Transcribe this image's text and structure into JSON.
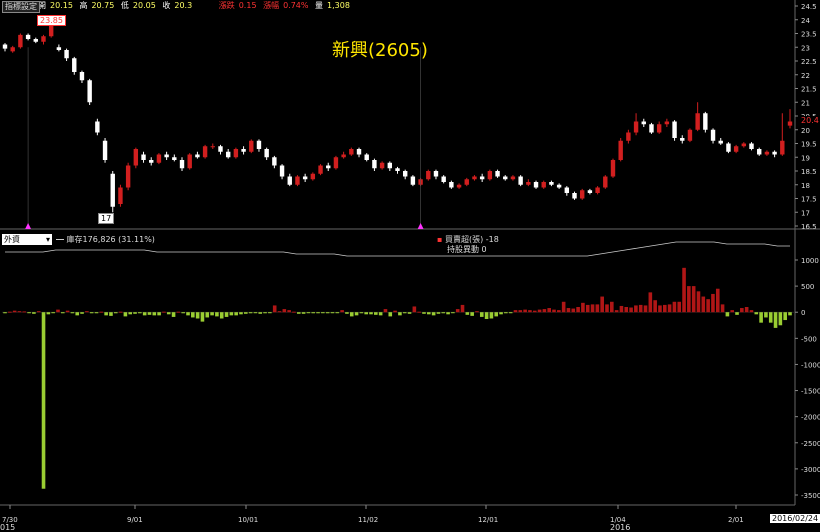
{
  "header": {
    "button": "指標設定",
    "open_label": "開",
    "open": "20.15",
    "high_label": "高",
    "high": "20.75",
    "low_label": "低",
    "low": "20.05",
    "close_label": "收",
    "close": "20.3",
    "change_label": "漲跌",
    "change": "0.15",
    "pct_label": "漲幅",
    "pct": "0.74%",
    "vol_label": "量",
    "vol": "1,308"
  },
  "title": "新興(2605)",
  "price_chart": {
    "type": "candlestick",
    "y_ticks": [
      "24.5",
      "24",
      "23.5",
      "23",
      "22.5",
      "22",
      "21.5",
      "21",
      "20.5",
      "20",
      "19.5",
      "19",
      "18.5",
      "18",
      "17.5",
      "17",
      "16.5"
    ],
    "high_label": "23.85",
    "low_label": "17",
    "last_label": "20.4",
    "candles": [
      [
        23.1,
        22.95,
        23.15,
        22.85
      ],
      [
        22.85,
        23.0,
        23.05,
        22.8
      ],
      [
        23.0,
        23.45,
        23.5,
        22.95
      ],
      [
        23.45,
        23.3,
        23.5,
        23.25
      ],
      [
        23.3,
        23.2,
        23.35,
        23.15
      ],
      [
        23.2,
        23.4,
        23.45,
        23.1
      ],
      [
        23.4,
        23.8,
        23.85,
        23.35
      ],
      [
        23.0,
        22.9,
        23.1,
        22.85
      ],
      [
        22.9,
        22.6,
        22.95,
        22.5
      ],
      [
        22.6,
        22.1,
        22.65,
        22.0
      ],
      [
        22.1,
        21.8,
        22.15,
        21.7
      ],
      [
        21.8,
        21.0,
        21.85,
        20.9
      ],
      [
        20.3,
        19.9,
        20.4,
        19.8
      ],
      [
        19.6,
        18.9,
        19.7,
        18.8
      ],
      [
        18.4,
        17.2,
        18.5,
        17.0
      ],
      [
        17.3,
        17.9,
        18.0,
        17.2
      ],
      [
        17.9,
        18.7,
        18.8,
        17.8
      ],
      [
        18.7,
        19.3,
        19.35,
        18.6
      ],
      [
        19.1,
        18.9,
        19.2,
        18.8
      ],
      [
        18.9,
        18.8,
        19.0,
        18.7
      ],
      [
        18.8,
        19.1,
        19.15,
        18.75
      ],
      [
        19.1,
        19.0,
        19.2,
        18.9
      ],
      [
        19.0,
        18.9,
        19.1,
        18.85
      ],
      [
        18.9,
        18.6,
        19.0,
        18.5
      ],
      [
        18.6,
        19.1,
        19.15,
        18.55
      ],
      [
        19.1,
        19.0,
        19.2,
        18.95
      ],
      [
        19.0,
        19.4,
        19.45,
        18.95
      ],
      [
        19.4,
        19.4,
        19.5,
        19.3
      ],
      [
        19.4,
        19.2,
        19.45,
        19.1
      ],
      [
        19.2,
        19.0,
        19.3,
        18.95
      ],
      [
        19.0,
        19.3,
        19.35,
        18.95
      ],
      [
        19.3,
        19.2,
        19.4,
        19.1
      ],
      [
        19.2,
        19.6,
        19.65,
        19.15
      ],
      [
        19.6,
        19.3,
        19.65,
        19.2
      ],
      [
        19.3,
        19.0,
        19.35,
        18.9
      ],
      [
        19.0,
        18.7,
        19.05,
        18.6
      ],
      [
        18.7,
        18.3,
        18.75,
        18.2
      ],
      [
        18.3,
        18.0,
        18.4,
        17.95
      ],
      [
        18.0,
        18.3,
        18.35,
        17.95
      ],
      [
        18.3,
        18.2,
        18.4,
        18.1
      ],
      [
        18.2,
        18.4,
        18.45,
        18.15
      ],
      [
        18.4,
        18.7,
        18.75,
        18.35
      ],
      [
        18.7,
        18.6,
        18.8,
        18.5
      ],
      [
        18.6,
        19.0,
        19.05,
        18.55
      ],
      [
        19.0,
        19.1,
        19.2,
        18.95
      ],
      [
        19.1,
        19.3,
        19.35,
        19.05
      ],
      [
        19.3,
        19.1,
        19.35,
        19.0
      ],
      [
        19.1,
        18.9,
        19.15,
        18.85
      ],
      [
        18.9,
        18.6,
        18.95,
        18.5
      ],
      [
        18.6,
        18.8,
        18.85,
        18.55
      ],
      [
        18.8,
        18.6,
        18.85,
        18.5
      ],
      [
        18.6,
        18.5,
        18.65,
        18.4
      ],
      [
        18.5,
        18.3,
        18.55,
        18.2
      ],
      [
        18.3,
        18.0,
        18.35,
        17.95
      ],
      [
        18.0,
        18.2,
        18.25,
        17.95
      ],
      [
        18.2,
        18.5,
        18.55,
        18.15
      ],
      [
        18.5,
        18.3,
        18.55,
        18.2
      ],
      [
        18.3,
        18.1,
        18.35,
        18.05
      ],
      [
        18.1,
        17.9,
        18.15,
        17.85
      ],
      [
        17.9,
        18.0,
        18.05,
        17.85
      ],
      [
        18.0,
        18.2,
        18.25,
        17.95
      ],
      [
        18.2,
        18.3,
        18.35,
        18.15
      ],
      [
        18.3,
        18.2,
        18.4,
        18.1
      ],
      [
        18.2,
        18.5,
        18.55,
        18.15
      ],
      [
        18.5,
        18.3,
        18.55,
        18.25
      ],
      [
        18.3,
        18.2,
        18.35,
        18.15
      ],
      [
        18.2,
        18.3,
        18.35,
        18.15
      ],
      [
        18.3,
        18.0,
        18.35,
        17.95
      ],
      [
        18.0,
        18.1,
        18.2,
        17.95
      ],
      [
        18.1,
        17.9,
        18.15,
        17.85
      ],
      [
        17.9,
        18.1,
        18.15,
        17.85
      ],
      [
        18.1,
        18.0,
        18.15,
        17.95
      ],
      [
        18.0,
        17.9,
        18.05,
        17.85
      ],
      [
        17.9,
        17.7,
        17.95,
        17.6
      ],
      [
        17.7,
        17.5,
        17.75,
        17.45
      ],
      [
        17.5,
        17.8,
        17.85,
        17.45
      ],
      [
        17.8,
        17.7,
        17.85,
        17.65
      ],
      [
        17.7,
        17.9,
        17.95,
        17.65
      ],
      [
        17.9,
        18.3,
        18.35,
        17.85
      ],
      [
        18.3,
        18.9,
        18.95,
        18.25
      ],
      [
        18.9,
        19.6,
        19.7,
        18.85
      ],
      [
        19.6,
        19.9,
        20.0,
        19.5
      ],
      [
        19.9,
        20.3,
        20.6,
        19.8
      ],
      [
        20.3,
        20.2,
        20.4,
        20.1
      ],
      [
        20.2,
        19.9,
        20.25,
        19.85
      ],
      [
        19.9,
        20.2,
        20.3,
        19.85
      ],
      [
        20.2,
        20.3,
        20.4,
        20.1
      ],
      [
        20.3,
        19.7,
        20.35,
        19.6
      ],
      [
        19.7,
        19.6,
        19.8,
        19.5
      ],
      [
        19.6,
        20.0,
        20.05,
        19.55
      ],
      [
        20.0,
        20.6,
        21.0,
        19.95
      ],
      [
        20.6,
        20.0,
        20.65,
        19.9
      ],
      [
        20.0,
        19.6,
        20.05,
        19.5
      ],
      [
        19.6,
        19.5,
        19.7,
        19.45
      ],
      [
        19.5,
        19.2,
        19.55,
        19.15
      ],
      [
        19.2,
        19.4,
        19.45,
        19.15
      ],
      [
        19.4,
        19.5,
        19.55,
        19.35
      ],
      [
        19.5,
        19.3,
        19.55,
        19.25
      ],
      [
        19.3,
        19.1,
        19.35,
        19.05
      ],
      [
        19.1,
        19.2,
        19.25,
        19.05
      ],
      [
        19.2,
        19.1,
        19.25,
        19.0
      ],
      [
        19.1,
        19.6,
        20.6,
        19.05
      ],
      [
        20.15,
        20.3,
        20.75,
        20.05
      ]
    ],
    "markers": [
      3,
      54
    ]
  },
  "indicator": {
    "select_value": "外資",
    "inventory_label": "庫存176,826 (31.11%)",
    "buy_sell_label": "買賣超(張)",
    "buy_sell_value": "-18",
    "hold_change_label": "持股異動",
    "hold_change_value": "0",
    "y_ticks": [
      "1000",
      "500",
      "0",
      "-500",
      "-1000",
      "-1500",
      "-2000",
      "-2500",
      "-3000",
      "-3500"
    ],
    "bars": [
      -20,
      10,
      30,
      20,
      15,
      -5,
      -30,
      20,
      -3380,
      -40,
      -10,
      50,
      -20,
      30,
      -20,
      -60,
      -30,
      20,
      -20,
      -20,
      10,
      -60,
      -70,
      -20,
      10,
      -80,
      -40,
      -30,
      -20,
      -60,
      -50,
      -60,
      -60,
      10,
      -40,
      -90,
      10,
      -20,
      -60,
      -100,
      -120,
      -180,
      -100,
      -60,
      -80,
      -120,
      -90,
      -60,
      -60,
      -40,
      -30,
      -20,
      -10,
      -30,
      -20,
      -10,
      130,
      20,
      60,
      40,
      10,
      -30,
      -30,
      -10,
      -20,
      -20,
      -10,
      -20,
      -10,
      -10,
      40,
      -30,
      -80,
      -60,
      -20,
      -40,
      -40,
      -50,
      -60,
      60,
      -80,
      30,
      -60,
      -20,
      -30,
      110,
      10,
      -30,
      -40,
      -60,
      -30,
      -20,
      -40,
      -10,
      60,
      140,
      -50,
      -70,
      20,
      -90,
      -130,
      -120,
      -80,
      -40,
      -20,
      -10,
      40,
      40,
      50,
      40,
      30,
      50,
      60,
      80,
      50,
      40,
      200,
      80,
      70,
      100,
      180,
      140,
      150,
      150,
      300,
      150,
      200,
      40,
      120,
      100,
      90,
      130,
      140,
      130,
      380,
      230,
      130,
      140,
      150,
      200,
      200,
      850,
      500,
      500,
      400,
      300,
      250,
      350,
      450,
      150,
      -80,
      40,
      -50,
      80,
      100,
      40,
      -40,
      -200,
      -100,
      -200,
      -300,
      -250,
      -150,
      -60
    ],
    "inventory_line": [
      0.95,
      0.95,
      0.95,
      0.95,
      0.96,
      0.96,
      0.96,
      0.96,
      0.96,
      0.96,
      0.96,
      0.96,
      0.95,
      0.95,
      0.95,
      0.95,
      0.95,
      0.95,
      0.95,
      0.95,
      0.95,
      0.95,
      0.95,
      0.94,
      0.94,
      0.94,
      0.94,
      0.93,
      0.93,
      0.93,
      0.93,
      0.93,
      0.93,
      0.93,
      0.93,
      0.93,
      0.93,
      0.93,
      0.93,
      0.93,
      0.93,
      0.93,
      0.93,
      0.93,
      0.93,
      0.93,
      0.93,
      0.94,
      0.95,
      0.96,
      0.97,
      0.98,
      0.99,
      1.0,
      1.0,
      1.0,
      1.0,
      0.99,
      0.99,
      0.99,
      0.99,
      0.98,
      0.98
    ]
  },
  "x_axis": {
    "labels": [
      "7/30",
      "9/01",
      "10/01",
      "11/02",
      "12/01",
      "1/04",
      "2/01"
    ],
    "year_left": "015",
    "year_right": "2016",
    "date_box": "2016/02/24"
  },
  "colors": {
    "up": "#d21f1f",
    "down": "#ffffff",
    "pos_bar": "#b01616",
    "neg_bar": "#9acd32",
    "marker": "#ff33ff"
  }
}
